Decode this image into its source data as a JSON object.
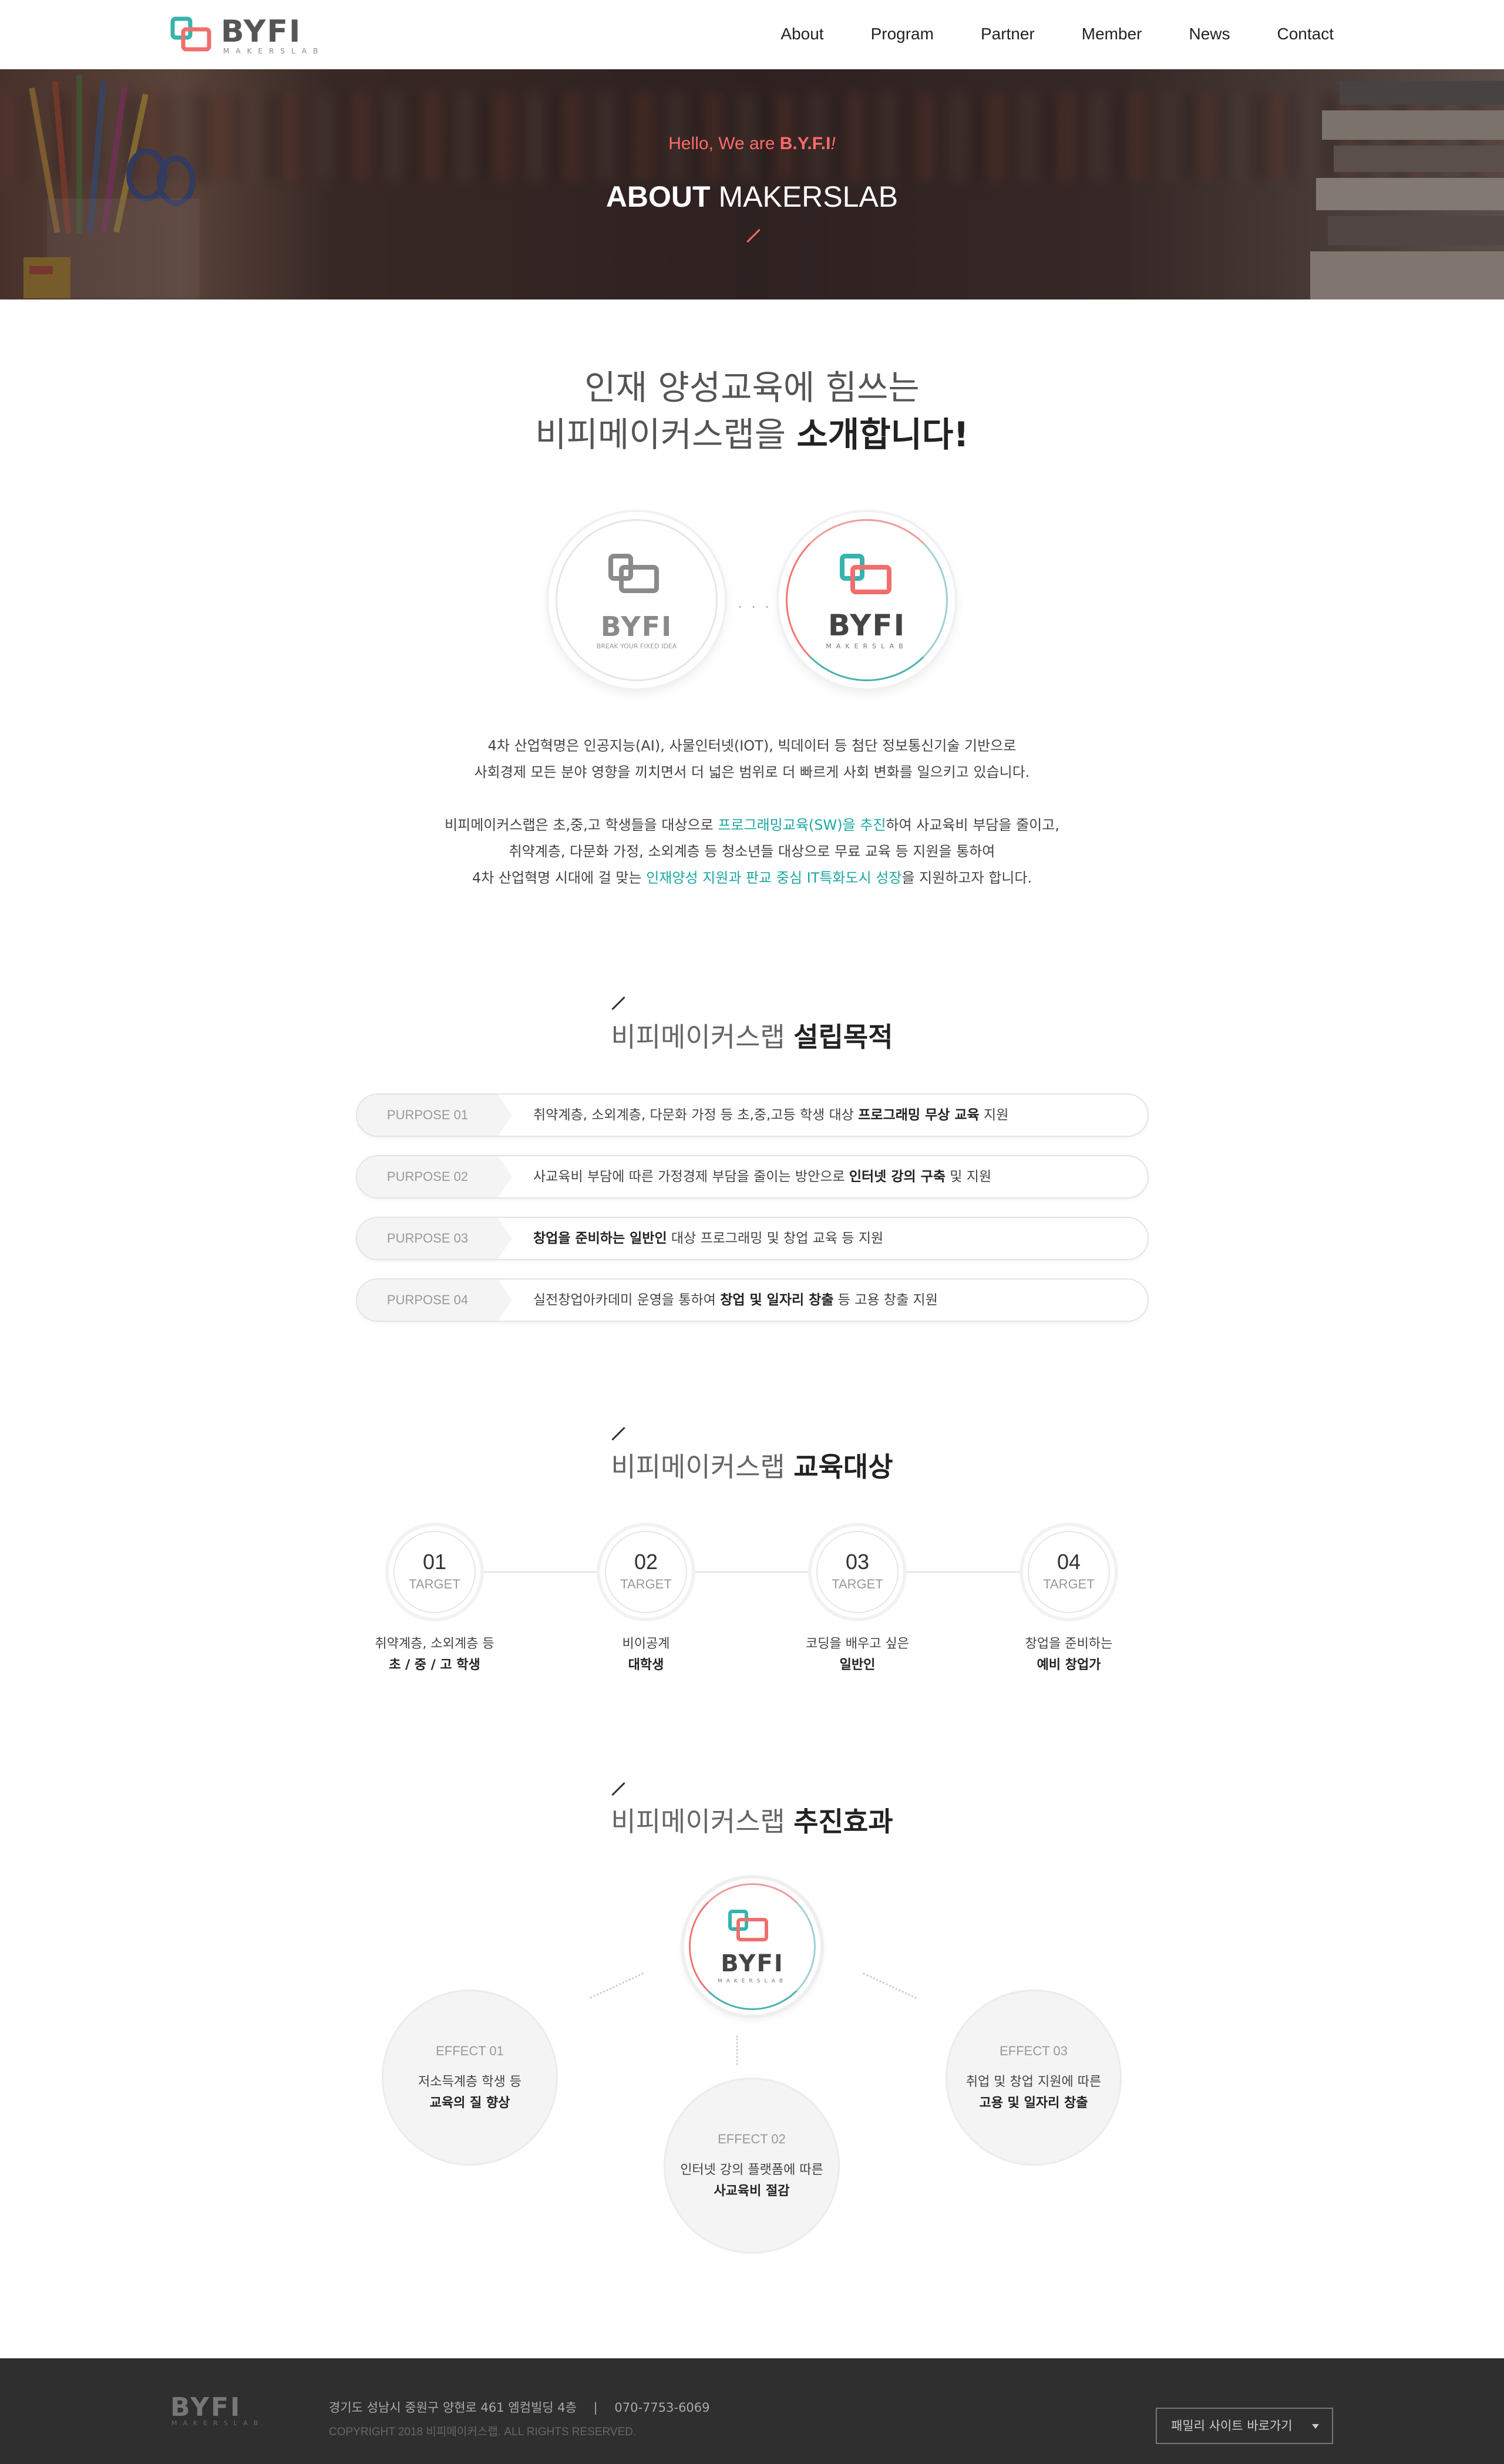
{
  "header": {
    "logo_text": "BYFI",
    "logo_sub": "MAKERSLAB",
    "nav": [
      "About",
      "Program",
      "Partner",
      "Member",
      "News",
      "Contact"
    ]
  },
  "hero": {
    "hello_prefix": "Hello, We are ",
    "hello_brand": "B.Y.F.I",
    "hello_suffix": "!",
    "title_bold": "ABOUT",
    "title_rest": " MAKERSLAB"
  },
  "intro": {
    "heading_line1": "인재 양성교육에 힘쓰는",
    "heading_line2_plain": "비피메이커스랩을 ",
    "heading_line2_bold": "소개합니다!",
    "old_logo_word": "BYFI",
    "old_logo_tag": "BREAK YOUR FIXED IDEA",
    "new_logo_word": "BYFI",
    "new_logo_tag": "MAKERSLAB",
    "p1_line1": "4차 산업혁명은 인공지능(AI), 사물인터넷(IOT), 빅데이터 등 첨단 정보통신기술 기반으로",
    "p1_line2": "사회경제 모든 분야 영향을 끼치면서 더 넓은 범위로 더 빠르게 사회 변화를 일으키고 있습니다.",
    "p2_line1_a": "비피메이커스랩은 초,중,고 학생들을 대상으로 ",
    "p2_line1_hl": "프로그래밍교육(SW)을 추진",
    "p2_line1_b": "하여 사교육비 부담을 줄이고,",
    "p2_line2": "취약계층, 다문화 가정, 소외계층 등 청소년들 대상으로 무료 교육 등 지원을 통하여",
    "p2_line3_a": "4차 산업혁명 시대에 걸 맞는 ",
    "p2_line3_hl": "인재양성 지원과 판교 중심 IT특화도시 성장",
    "p2_line3_b": "을 지원하고자 합니다."
  },
  "purpose_section": {
    "heading_plain": "비피메이커스랩 ",
    "heading_bold": "설립목적",
    "items": [
      {
        "tag": "PURPOSE 01",
        "a": "취약계층, 소외계층, 다문화 가정 등 초,중,고등 학생 대상 ",
        "b": "프로그래밍 무상 교육",
        "c": " 지원"
      },
      {
        "tag": "PURPOSE 02",
        "a": "사교육비 부담에 따른 가정경제 부담을 줄이는 방안으로 ",
        "b": "인터넷 강의 구축",
        "c": " 및 지원"
      },
      {
        "tag": "PURPOSE 03",
        "a": "",
        "b": "창업을 준비하는 일반인",
        "c": " 대상 프로그래밍 및 창업 교육 등 지원"
      },
      {
        "tag": "PURPOSE 04",
        "a": "실전창업아카데미 운영을 통하여 ",
        "b": "창업 및 일자리 창출",
        "c": " 등 고용 창출 지원"
      }
    ]
  },
  "target_section": {
    "heading_plain": "비피메이커스랩 ",
    "heading_bold": "교육대상",
    "items": [
      {
        "num": "01",
        "label": "TARGET",
        "line1": "취약계층, 소외계층 등",
        "line2": "초 / 중 / 고 학생"
      },
      {
        "num": "02",
        "label": "TARGET",
        "line1": "비이공계",
        "line2": "대학생"
      },
      {
        "num": "03",
        "label": "TARGET",
        "line1": "코딩을 배우고 싶은",
        "line2": "일반인"
      },
      {
        "num": "04",
        "label": "TARGET",
        "line1": "창업을 준비하는",
        "line2": "예비 창업가"
      }
    ]
  },
  "effect_section": {
    "heading_plain": "비피메이커스랩 ",
    "heading_bold": "추진효과",
    "logo_word": "BYFI",
    "logo_sub": "MAKERSLAB",
    "items": [
      {
        "label": "EFFECT 01",
        "line1": "저소득계층 학생 등",
        "line2": "교육의 질 향상"
      },
      {
        "label": "EFFECT 02",
        "line1": "인터넷 강의 플랫폼에 따른",
        "line2": "사교육비 절감"
      },
      {
        "label": "EFFECT 03",
        "line1": "취업 및 창업 지원에 따른",
        "line2": "고용 및 일자리 창출"
      }
    ]
  },
  "footer": {
    "logo": "BYFI",
    "logo_sub": "MAKERSLAB",
    "address": "경기도 성남시 중원구 양현로 461 엠컴빌딩 4층",
    "sep": "|",
    "phone": "070-7753-6069",
    "copyright": "COPYRIGHT 2018 비피메이커스랩. ALL RIGHTS RESERVED.",
    "family_site": "패밀리 사이트 바로가기"
  },
  "colors": {
    "accent_teal": "#1aa7a1",
    "accent_coral": "#ff6b6b",
    "footer_bg": "#2f2f2f"
  }
}
